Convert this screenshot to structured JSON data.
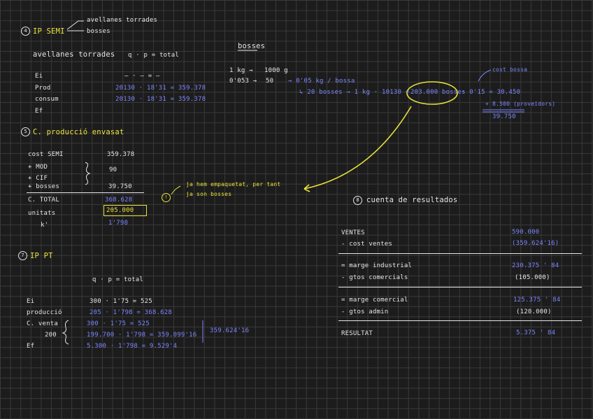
{
  "colors": {
    "background": "#1c1c1c",
    "grid": "#3a3a3a",
    "text": "#e6e6e6",
    "highlight": "#e8e23a",
    "value": "#7d86ff"
  },
  "s4": {
    "number": "4",
    "title": "IP SEMI",
    "branch1": "avellanes torrades",
    "branch2": "bosses",
    "subtitle": "avellanes torrades",
    "formula": "q · p = total",
    "rows": [
      {
        "label": "Ei",
        "value": "— · — = —"
      },
      {
        "label": "Prod",
        "value": "20130 · 18'31 = 359.378"
      },
      {
        "label": "consum",
        "value": "20130 · 18'31 = 359.378"
      },
      {
        "label": "Ef",
        "value": ""
      }
    ]
  },
  "bosses": {
    "title": "bosses",
    "line1a": "1 kg →",
    "line1b": "1000 g",
    "line2a": "0'053 →",
    "line2b": "50",
    "line2c": "→ 0'05 kg / bossa",
    "line3": "↳ 20 bosses → 1 kg · 10130 =",
    "circled": "203.000 bosses",
    "mult": "· 0'15 = 30.450",
    "cost_label": "cost bossa",
    "plus": "+ 8.500 (proveïdors)",
    "total": "39.750"
  },
  "s5": {
    "number": "5",
    "title": "C. producció envasat",
    "rows": [
      {
        "label": "cost SEMI",
        "value": "359.378"
      },
      {
        "label": "+ MOD",
        "value": ""
      },
      {
        "label": "+ CIF",
        "value": "90"
      },
      {
        "label": "+ bosses",
        "value": "39.750"
      }
    ],
    "total_label": "C. TOTAL",
    "total_value": "368.628",
    "units_label": "unitats",
    "units_value": "205.000",
    "k_label": "k'",
    "k_value": "1'798",
    "note_mark": "!",
    "note_line1": "ja hem empaquetat, per tant",
    "note_line2": "ja son bosses"
  },
  "s7": {
    "number": "7",
    "title": "IP PT",
    "formula": "q · p = total",
    "rows": [
      {
        "label": "Ei",
        "value": "300 · 1'75 = 525"
      },
      {
        "label": "producció",
        "value": "205 · 1'798 = 368.628"
      },
      {
        "label": "C. venta",
        "value": "300 · 1'75 = 525"
      },
      {
        "label": "",
        "value": "199.700 · 1'798 = 359.099'16"
      },
      {
        "label": "Ef",
        "value": "5.300 · 1'798 = 9.529'4"
      }
    ],
    "sub_label": "200",
    "brace_total": "359.624'16"
  },
  "s8": {
    "number": "8",
    "title": "cuenta de resultados",
    "rows": [
      {
        "label": "VENTES",
        "value": "590.000"
      },
      {
        "label": "- cost ventes",
        "value": "(359.624'16)"
      },
      {
        "label": "= marge industrial",
        "value": "230.375 ' 84"
      },
      {
        "label": "- gtos comercials",
        "value": "(105.000)"
      },
      {
        "label": "= marge comercial",
        "value": "125.375 ' 84"
      },
      {
        "label": "- gtos admin",
        "value": "(120.000)"
      },
      {
        "label": "RESULTAT",
        "value": "5.375 ' 84"
      }
    ]
  }
}
